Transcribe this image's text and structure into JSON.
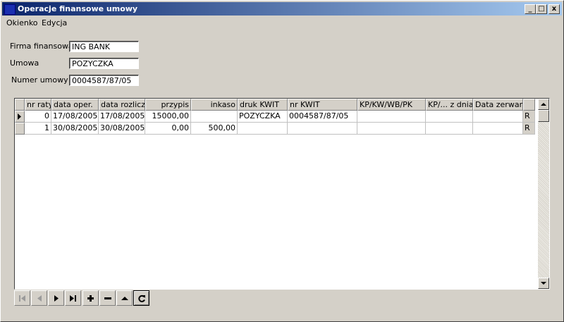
{
  "window": {
    "title": "Operacje finansowe umowy",
    "minimize_glyph": "_",
    "maximize_glyph": "□",
    "close_glyph": "x"
  },
  "menu": [
    "Okienko",
    "Edycja"
  ],
  "form": {
    "firma_label": "Firma finansowa",
    "firma_value": "ING BANK",
    "umowa_label": "Umowa",
    "umowa_value": "POZYCZKA",
    "numer_label": "Numer umowy",
    "numer_value": "0004587/87/05"
  },
  "grid": {
    "columns": [
      "nr raty",
      "data oper.",
      "data rozlicz.",
      "przypis",
      "inkaso",
      "druk KWIT",
      "nr KWIT",
      "KP/KW/WB/PK",
      "KP/... z dnia",
      "Data zerwania",
      ""
    ],
    "rows": [
      [
        "0",
        "17/08/2005",
        "17/08/2005",
        "15000,00",
        "",
        "POZYCZKA",
        "0004587/87/05",
        "",
        "",
        "",
        "R"
      ],
      [
        "1",
        "30/08/2005",
        "30/08/2005",
        "0,00",
        "500,00",
        "",
        "",
        "",
        "",
        "",
        "R"
      ]
    ],
    "current_row": 0
  },
  "navigator": {
    "buttons": [
      "first-icon",
      "prior-icon",
      "next-icon",
      "last-icon",
      "insert-icon",
      "delete-icon",
      "edit-icon",
      "refresh-icon"
    ]
  },
  "colors": {
    "title_start": "#0a246a",
    "title_end": "#a6caf0",
    "face": "#d4d0c8"
  }
}
